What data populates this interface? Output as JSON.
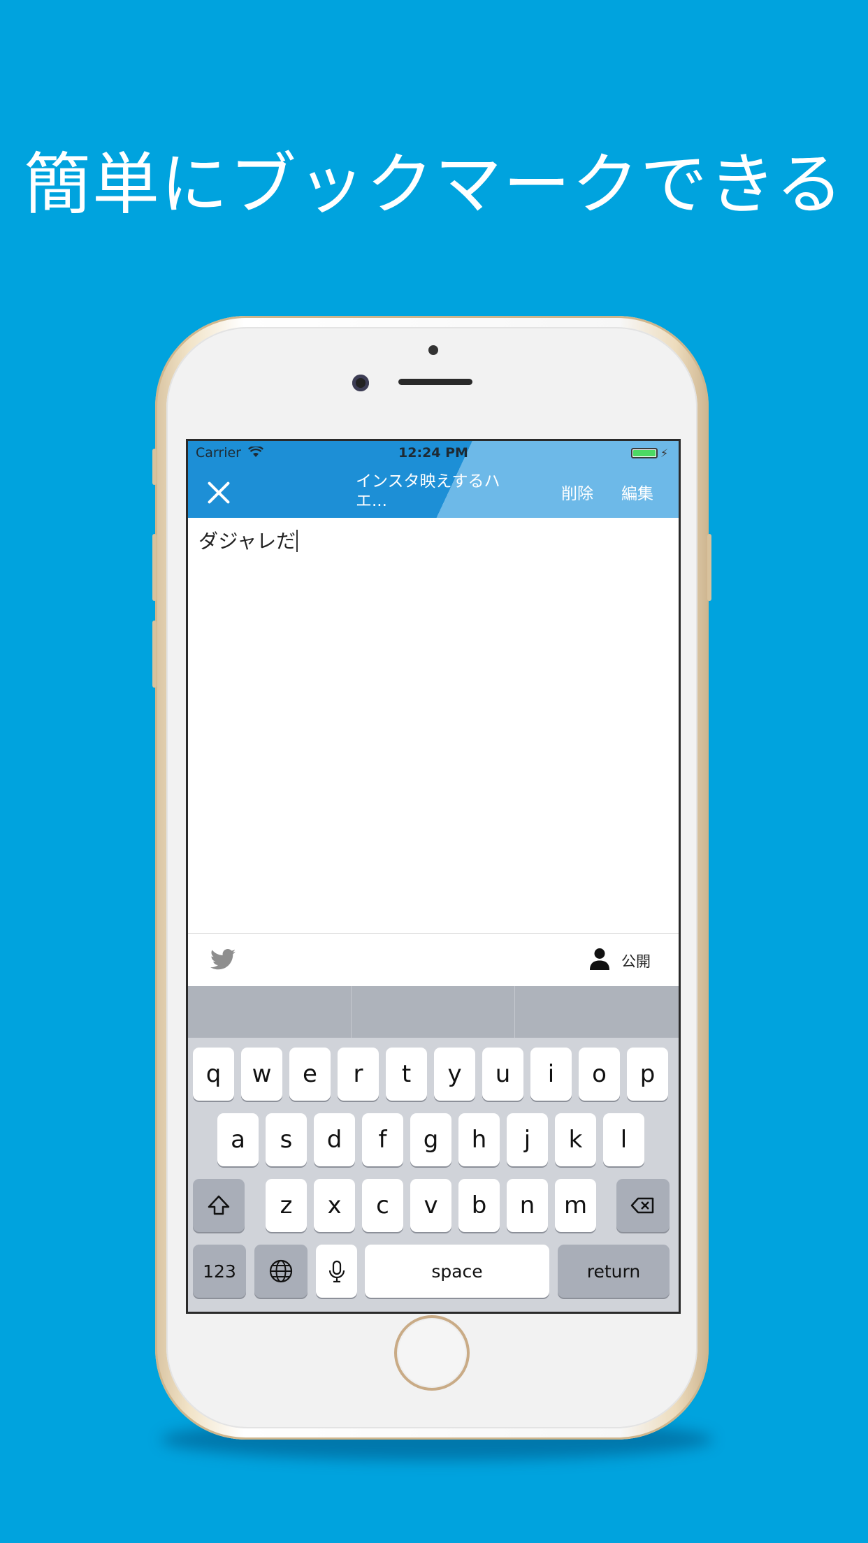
{
  "headline": "簡単にブックマークできる",
  "status_bar": {
    "carrier": "Carrier",
    "time": "12:24 PM"
  },
  "nav": {
    "title": "インスタ映えするハエ...",
    "delete_label": "削除",
    "edit_label": "編集"
  },
  "editor": {
    "text": "ダジャレだ"
  },
  "toolbar": {
    "visibility_label": "公開"
  },
  "keyboard": {
    "row1": [
      "q",
      "w",
      "e",
      "r",
      "t",
      "y",
      "u",
      "i",
      "o",
      "p"
    ],
    "row2": [
      "a",
      "s",
      "d",
      "f",
      "g",
      "h",
      "j",
      "k",
      "l"
    ],
    "row3": [
      "z",
      "x",
      "c",
      "v",
      "b",
      "n",
      "m"
    ],
    "numbers_label": "123",
    "space_label": "space",
    "return_label": "return"
  },
  "colors": {
    "background": "#00a3de",
    "nav_primary": "#1d8fd6",
    "nav_secondary": "#6db9e8",
    "battery": "#4cd964"
  }
}
